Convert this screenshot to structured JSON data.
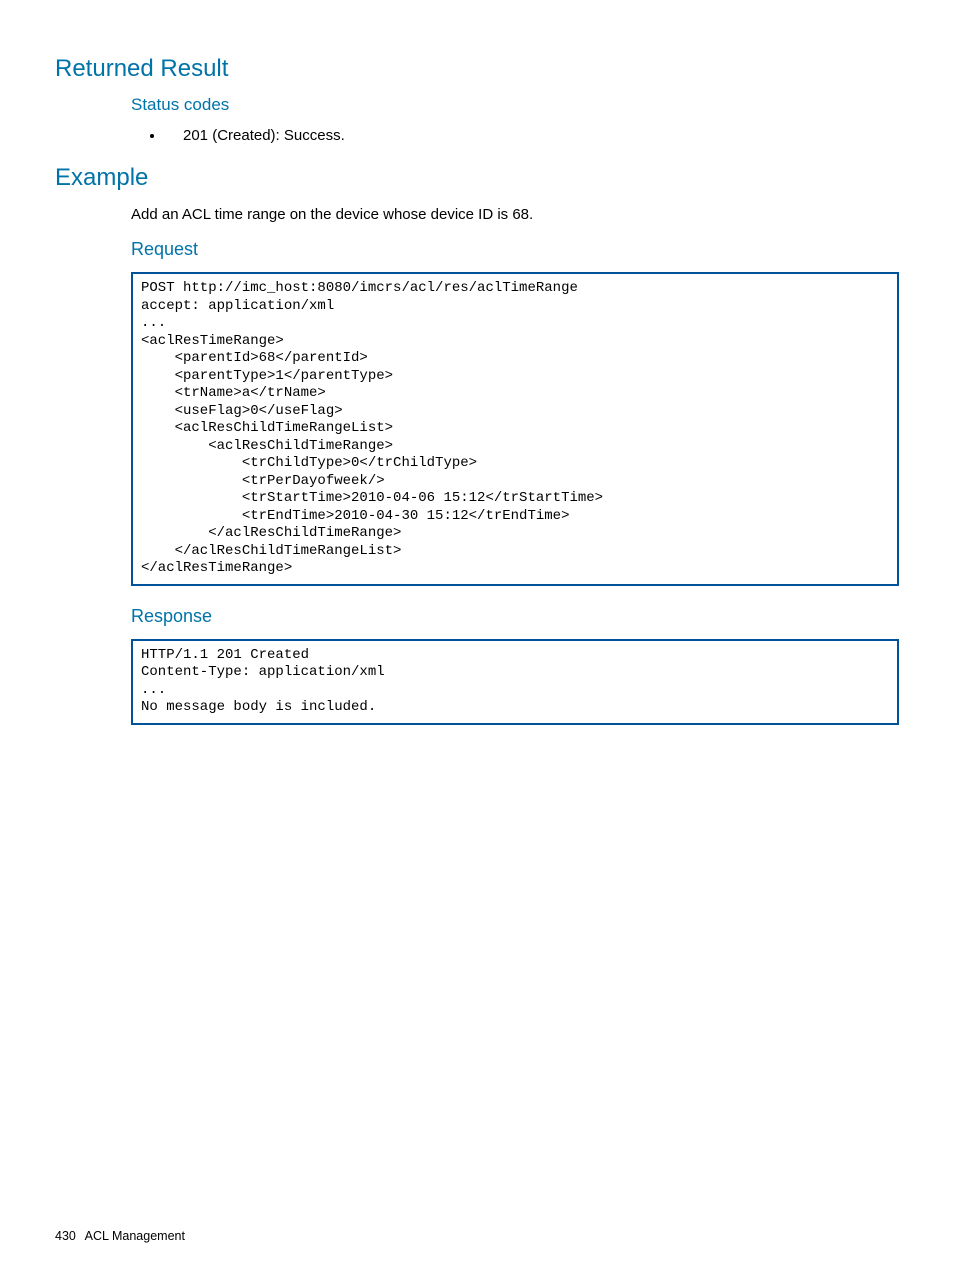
{
  "sections": {
    "returnedResult": {
      "heading": "Returned Result",
      "statusCodes": {
        "label": "Status codes",
        "item": "201 (Created): Success."
      }
    },
    "example": {
      "heading": "Example",
      "intro": "Add an ACL time range on the device whose device ID is 68.",
      "request": {
        "label": "Request",
        "code": "POST http://imc_host:8080/imcrs/acl/res/aclTimeRange\naccept: application/xml\n...\n<aclResTimeRange>\n    <parentId>68</parentId>\n    <parentType>1</parentType>\n    <trName>a</trName>\n    <useFlag>0</useFlag>\n    <aclResChildTimeRangeList>\n        <aclResChildTimeRange>\n            <trChildType>0</trChildType>\n            <trPerDayofweek/>\n            <trStartTime>2010-04-06 15:12</trStartTime>\n            <trEndTime>2010-04-30 15:12</trEndTime>\n        </aclResChildTimeRange>\n    </aclResChildTimeRangeList>\n</aclResTimeRange>"
      },
      "response": {
        "label": "Response",
        "code": "HTTP/1.1 201 Created\nContent-Type: application/xml\n...\nNo message body is included."
      }
    }
  },
  "footer": {
    "page": "430",
    "section": "ACL Management"
  }
}
